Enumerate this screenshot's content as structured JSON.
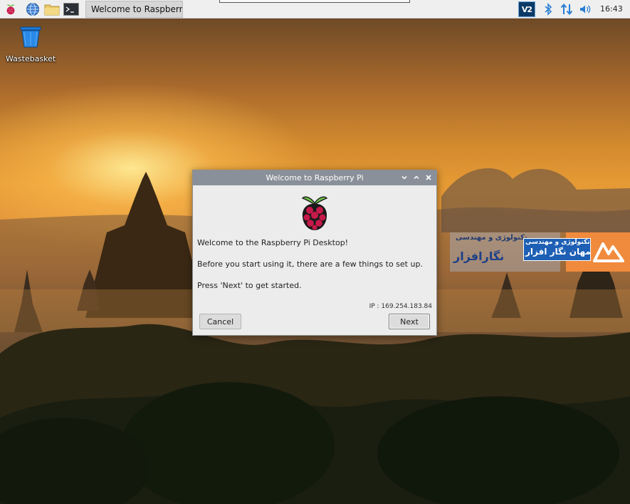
{
  "panel": {
    "launchers": [
      {
        "icon": "raspberry-menu-icon"
      },
      {
        "icon": "web-browser-icon"
      },
      {
        "icon": "file-manager-icon"
      },
      {
        "icon": "terminal-icon"
      }
    ],
    "taskbar_item": {
      "icon": "raspberry-icon",
      "label": "Welcome to Raspberr..."
    },
    "tray": {
      "vnc_label": "V2",
      "bluetooth_icon": "bluetooth-icon",
      "network_icon": "network-arrows-icon",
      "volume_icon": "volume-icon",
      "clock": "16:43"
    }
  },
  "desktop": {
    "icons": [
      {
        "icon": "wastebasket-icon",
        "label": "Wastebasket"
      }
    ]
  },
  "dialog": {
    "title": "Welcome to Raspberry Pi",
    "controls": {
      "minimize": "chevron-down-icon",
      "maximize": "chevron-up-icon",
      "close": "close-icon"
    },
    "logo_icon": "raspberry-pi-logo-icon",
    "lines": [
      "Welcome to the Raspberry Pi Desktop!",
      "Before you start using it, there are a few things to set up.",
      "Press 'Next' to get started."
    ],
    "ip": "IP : 169.254.183.84",
    "buttons": {
      "cancel": "Cancel",
      "next": "Next"
    }
  },
  "watermark": {
    "top_text": "تکنولوژی و مهندسی",
    "brand": "نگارافزار",
    "brand_small": "تکنولوژی و مهندسی",
    "brand_blue": "مهان نگار افزار"
  },
  "colors": {
    "panel_bg": "#efefef",
    "titlebar_bg": "#8a9099",
    "dialog_bg": "#ececec",
    "raspberry_red": "#c51a4a",
    "leaf_green": "#6cc04a",
    "accent_orange": "#f08a3c",
    "accent_blue": "#1d5fb4"
  }
}
